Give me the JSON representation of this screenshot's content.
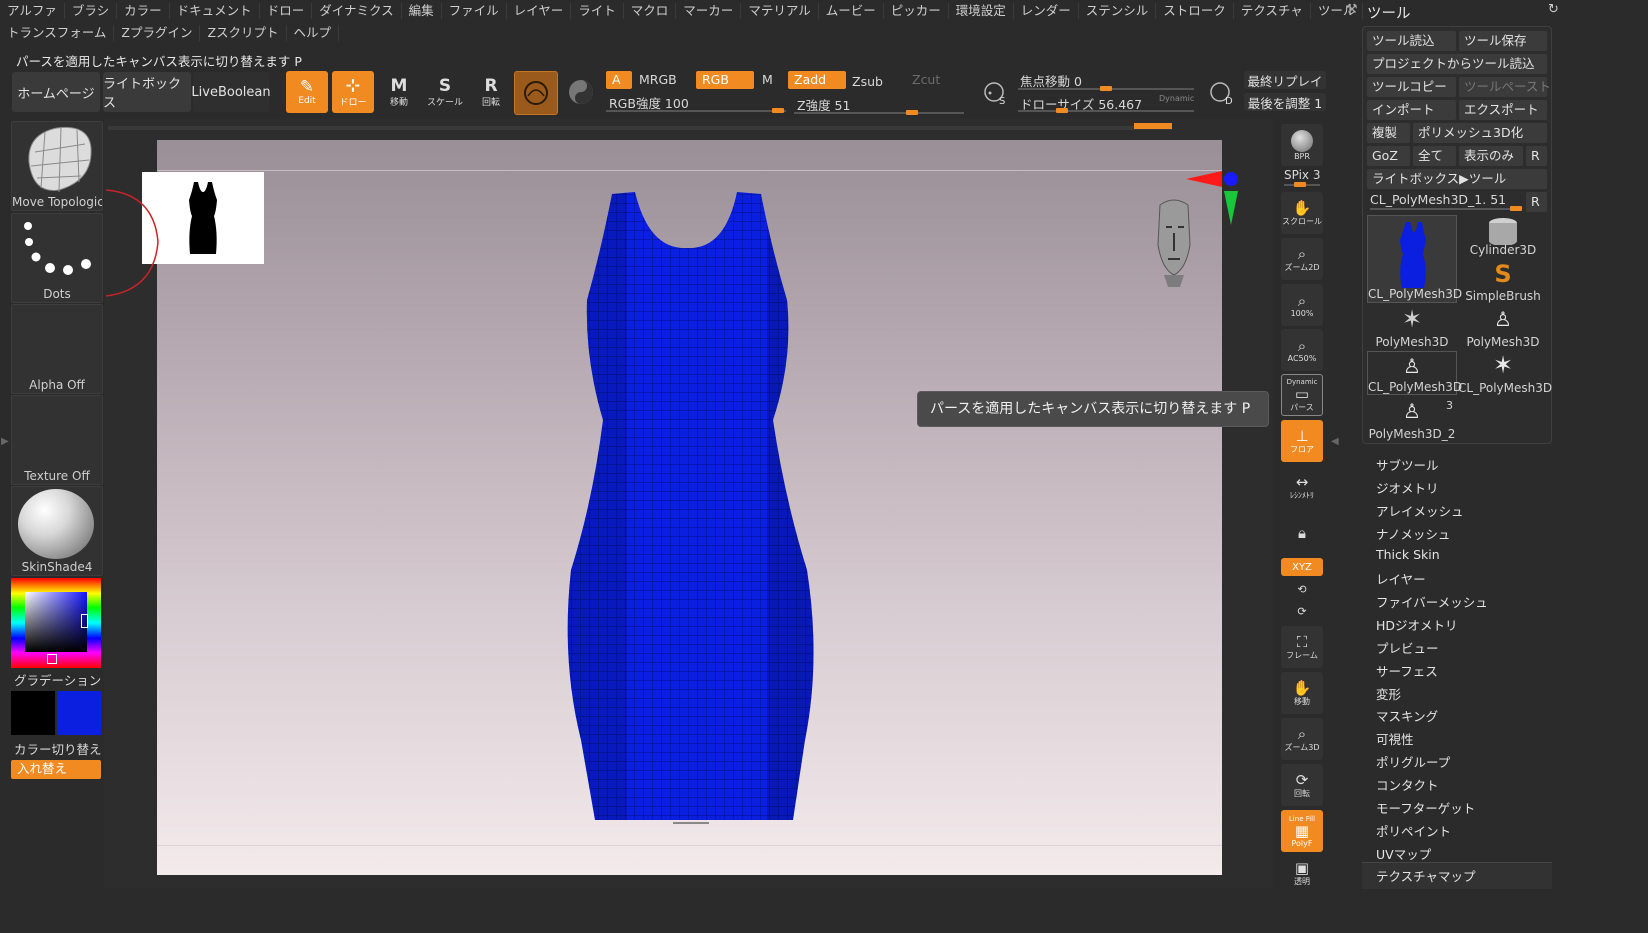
{
  "menu": {
    "row1": [
      "アルファ",
      "ブラシ",
      "カラー",
      "ドキュメント",
      "ドロー",
      "ダイナミクス",
      "編集",
      "ファイル",
      "レイヤー",
      "ライト",
      "マクロ",
      "マーカー",
      "マテリアル",
      "ムービー",
      "ピッカー",
      "環境設定",
      "レンダー",
      "ステンシル",
      "ストローク",
      "テクスチャ",
      "ツール"
    ],
    "row2": [
      "トランスフォーム",
      "Zプラグイン",
      "Zスクリプト",
      "ヘルプ"
    ]
  },
  "status_text": "パースを適用したキャンバス表示に切り替えます P",
  "shelf": {
    "homepage": "ホームページ",
    "lightbox": "ライトボックス",
    "liveboolean": "LiveBoolean",
    "edit": "Edit",
    "draw": "ドロー",
    "move": "移動",
    "scale": "スケール",
    "rotate": "回転",
    "a": "A",
    "mrgb": "MRGB",
    "rgb": "RGB",
    "m": "M",
    "zadd": "Zadd",
    "zsub": "Zsub",
    "zcut": "Zcut",
    "rgb_intensity": "RGB強度 100",
    "z_intensity": "Z強度 51",
    "focal_shift": "焦点移動 0",
    "draw_size": "ドローサイズ 56.467",
    "dynamic": "Dynamic",
    "last_replay": "最終リプレイ",
    "last_adjust": "最後を調整 1",
    "s_key": "S",
    "d_key": "D"
  },
  "left_panel": {
    "brush": "Move Topologica",
    "stroke": "Dots",
    "alpha": "Alpha Off",
    "texture": "Texture Off",
    "material": "SkinShade4",
    "gradient": "グラデーション",
    "color_switch": "カラー切り替え",
    "swap": "入れ替え"
  },
  "tooltip": "パースを適用したキャンバス表示に切り替えます  P",
  "right_rail": {
    "bpr": "BPR",
    "spix": "SPix 3",
    "scroll": "スクロール",
    "zoom2d": "ズーム2D",
    "z100": "100%",
    "ac50": "AC50%",
    "dynamic": "Dynamic",
    "perspective": "パース",
    "floor": "フロア",
    "symmetry": "ﾚｼﾝﾒﾄﾘ",
    "xyz": "XYZ",
    "frame": "フレーム",
    "move": "移動",
    "zoom3d": "ズーム3D",
    "rotate": "回転",
    "linefill": "Line Fill",
    "polyf": "PolyF",
    "transp": "透明"
  },
  "tool_panel": {
    "title": "ツール",
    "load": "ツール読込",
    "save": "ツール保存",
    "load_project": "プロジェクトからツール読込",
    "copy": "ツールコピー",
    "paste": "ツールペースト",
    "import": "インポート",
    "export": "エクスポート",
    "clone": "複製",
    "make_polymesh": "ポリメッシュ3D化",
    "goz": "GoZ",
    "all": "全て",
    "visible_only": "表示のみ",
    "r": "R",
    "lightbox_tool": "ライトボックス▶ツール",
    "current_tool": "CL_PolyMesh3D_1. 51",
    "thumbs": [
      "CL_PolyMesh3D",
      "Cylinder3D",
      "SimpleBrush",
      "PolyMesh3D",
      "PolyMesh3D",
      "CL_PolyMesh3D",
      "CL_PolyMesh3D",
      "PolyMesh3D_2"
    ],
    "thumb_count": "3",
    "subpalettes": [
      "サブツール",
      "ジオメトリ",
      "アレイメッシュ",
      "ナノメッシュ",
      "Thick Skin",
      "レイヤー",
      "ファイバーメッシュ",
      "HDジオメトリ",
      "プレビュー",
      "サーフェス",
      "変形",
      "マスキング",
      "可視性",
      "ポリグループ",
      "コンタクト",
      "モーフターゲット",
      "ポリペイント",
      "UVマップ",
      "テクスチャマップ"
    ]
  },
  "colors": {
    "accent": "#f28a22",
    "mesh": "#0a1fe0",
    "panel": "#2b2b2b"
  }
}
